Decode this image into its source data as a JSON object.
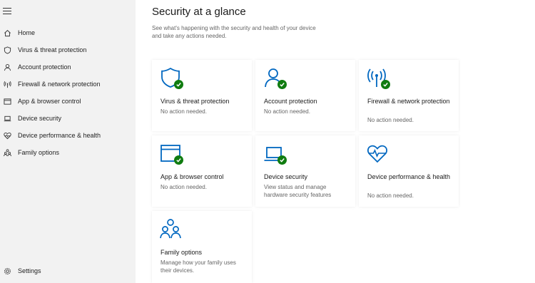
{
  "sidebar": {
    "items": [
      {
        "label": "Home",
        "icon": "home-icon"
      },
      {
        "label": "Virus & threat protection",
        "icon": "shield-icon"
      },
      {
        "label": "Account protection",
        "icon": "person-icon"
      },
      {
        "label": "Firewall & network protection",
        "icon": "antenna-icon"
      },
      {
        "label": "App & browser control",
        "icon": "app-window-icon"
      },
      {
        "label": "Device security",
        "icon": "laptop-icon"
      },
      {
        "label": "Device performance & health",
        "icon": "heart-icon"
      },
      {
        "label": "Family options",
        "icon": "family-icon"
      }
    ],
    "settings_label": "Settings",
    "menu_icon": "hamburger-icon"
  },
  "main": {
    "title": "Security at a glance",
    "subtitle": "See what's happening with the security and health of your device and take any actions needed."
  },
  "cards": [
    {
      "title": "Virus & threat protection",
      "status": "No action needed.",
      "icon": "shield-icon",
      "check": true
    },
    {
      "title": "Account protection",
      "status": "No action needed.",
      "icon": "person-icon",
      "check": true
    },
    {
      "title": "Firewall & network protection",
      "status": "No action needed.",
      "icon": "antenna-icon",
      "check": true
    },
    {
      "title": "App & browser control",
      "status": "No action needed.",
      "icon": "app-window-icon",
      "check": true
    },
    {
      "title": "Device security",
      "status": "View status and manage hardware security features",
      "icon": "laptop-icon",
      "check": true
    },
    {
      "title": "Device performance & health",
      "status": "No action needed.",
      "icon": "heart-pulse-icon",
      "check": false
    },
    {
      "title": "Family options",
      "status": "Manage how your family uses their devices.",
      "icon": "family-icon",
      "check": false
    }
  ],
  "colors": {
    "accent": "#0067c0",
    "ok": "#107c10",
    "sidebar_bg": "#f2f2f2"
  }
}
